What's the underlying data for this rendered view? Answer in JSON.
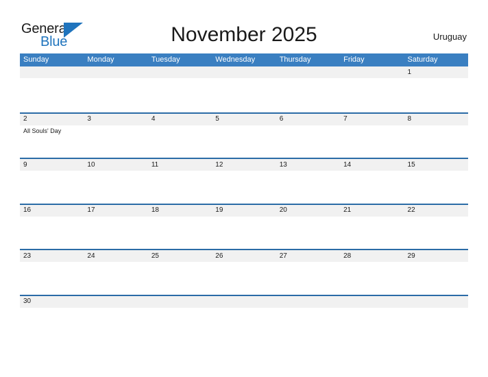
{
  "brand": {
    "name_part1": "General",
    "name_part2": "Blue",
    "triangle_icon": "triangle-icon",
    "color_blue": "#1f74bd",
    "color_dark": "#1a1a1a"
  },
  "header": {
    "title": "November 2025",
    "region": "Uruguay"
  },
  "theme": {
    "header_blue": "#3a7fc1",
    "divider_blue": "#2a6ba6",
    "band_gray": "#f1f1f1",
    "text_dark": "#1a1a1a",
    "white": "#ffffff"
  },
  "calendar": {
    "month": "November",
    "year": "2025",
    "weekdays": [
      "Sunday",
      "Monday",
      "Tuesday",
      "Wednesday",
      "Thursday",
      "Friday",
      "Saturday"
    ],
    "weeks": [
      {
        "days": [
          {
            "num": "",
            "events": []
          },
          {
            "num": "",
            "events": []
          },
          {
            "num": "",
            "events": []
          },
          {
            "num": "",
            "events": []
          },
          {
            "num": "",
            "events": []
          },
          {
            "num": "",
            "events": []
          },
          {
            "num": "1",
            "events": []
          }
        ]
      },
      {
        "days": [
          {
            "num": "2",
            "events": [
              "All Souls' Day"
            ]
          },
          {
            "num": "3",
            "events": []
          },
          {
            "num": "4",
            "events": []
          },
          {
            "num": "5",
            "events": []
          },
          {
            "num": "6",
            "events": []
          },
          {
            "num": "7",
            "events": []
          },
          {
            "num": "8",
            "events": []
          }
        ]
      },
      {
        "days": [
          {
            "num": "9",
            "events": []
          },
          {
            "num": "10",
            "events": []
          },
          {
            "num": "11",
            "events": []
          },
          {
            "num": "12",
            "events": []
          },
          {
            "num": "13",
            "events": []
          },
          {
            "num": "14",
            "events": []
          },
          {
            "num": "15",
            "events": []
          }
        ]
      },
      {
        "days": [
          {
            "num": "16",
            "events": []
          },
          {
            "num": "17",
            "events": []
          },
          {
            "num": "18",
            "events": []
          },
          {
            "num": "19",
            "events": []
          },
          {
            "num": "20",
            "events": []
          },
          {
            "num": "21",
            "events": []
          },
          {
            "num": "22",
            "events": []
          }
        ]
      },
      {
        "days": [
          {
            "num": "23",
            "events": []
          },
          {
            "num": "24",
            "events": []
          },
          {
            "num": "25",
            "events": []
          },
          {
            "num": "26",
            "events": []
          },
          {
            "num": "27",
            "events": []
          },
          {
            "num": "28",
            "events": []
          },
          {
            "num": "29",
            "events": []
          }
        ]
      },
      {
        "days": [
          {
            "num": "30",
            "events": []
          },
          {
            "num": "",
            "events": []
          },
          {
            "num": "",
            "events": []
          },
          {
            "num": "",
            "events": []
          },
          {
            "num": "",
            "events": []
          },
          {
            "num": "",
            "events": []
          },
          {
            "num": "",
            "events": []
          }
        ]
      }
    ]
  }
}
